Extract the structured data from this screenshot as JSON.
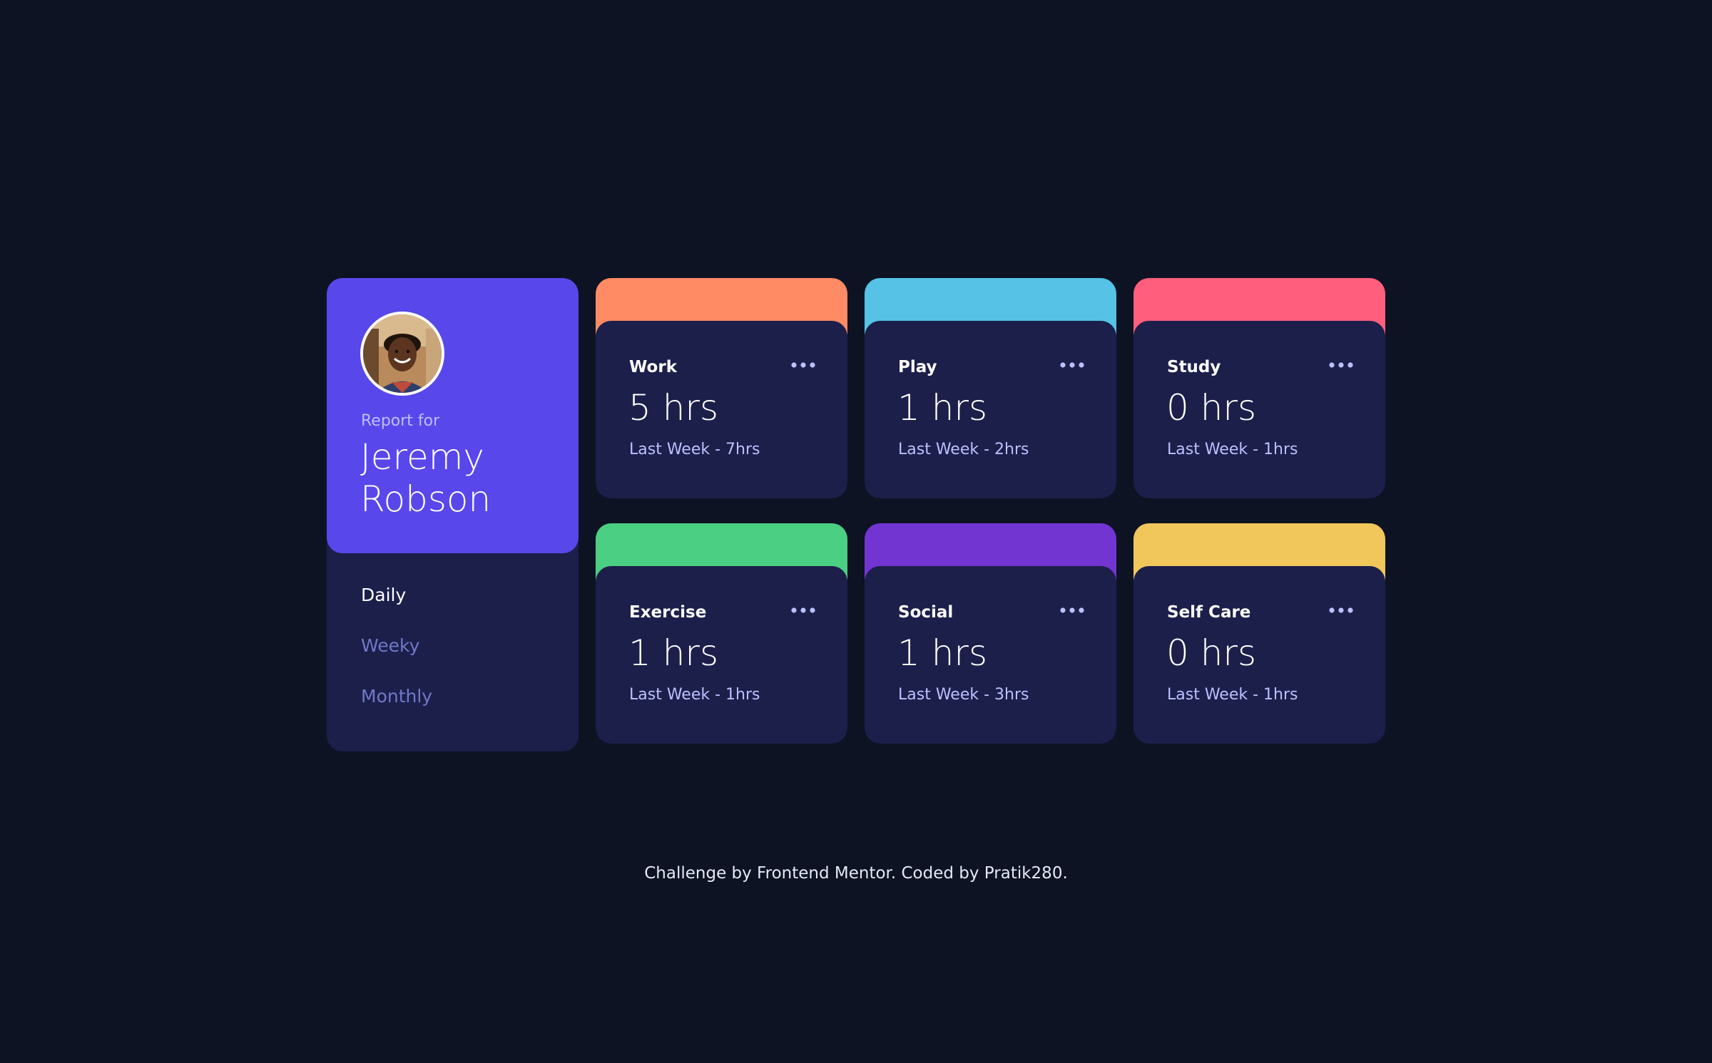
{
  "profile": {
    "report_label": "Report for",
    "name": "Jeremy Robson",
    "avatar_icon": "person-avatar-icon",
    "accent_color": "#5847eb"
  },
  "timeframes": {
    "items": [
      {
        "label": "Daily",
        "active": true
      },
      {
        "label": "Weeky",
        "active": false
      },
      {
        "label": "Monthly",
        "active": false
      }
    ]
  },
  "cards": [
    {
      "title": "Work",
      "current": "5 hrs",
      "previous": "Last Week - 7hrs",
      "color": "#ff8b64",
      "menu_icon": "ellipsis-icon"
    },
    {
      "title": "Play",
      "current": "1 hrs",
      "previous": "Last Week - 2hrs",
      "color": "#55c2e6",
      "menu_icon": "ellipsis-icon"
    },
    {
      "title": "Study",
      "current": "0 hrs",
      "previous": "Last Week - 1hrs",
      "color": "#ff5e7d",
      "menu_icon": "ellipsis-icon"
    },
    {
      "title": "Exercise",
      "current": "1 hrs",
      "previous": "Last Week - 1hrs",
      "color": "#4bcf82",
      "menu_icon": "ellipsis-icon"
    },
    {
      "title": "Social",
      "current": "1 hrs",
      "previous": "Last Week - 3hrs",
      "color": "#7335d2",
      "menu_icon": "ellipsis-icon"
    },
    {
      "title": "Self Care",
      "current": "0 hrs",
      "previous": "Last Week - 1hrs",
      "color": "#f1c75b",
      "menu_icon": "ellipsis-icon"
    }
  ],
  "footer": {
    "text": "Challenge by Frontend Mentor. Coded by Pratik280."
  }
}
